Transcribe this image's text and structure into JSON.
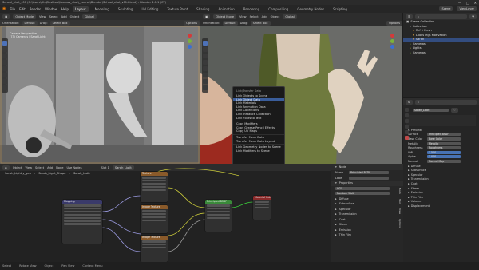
{
  "window": {
    "title": "School_shot_v01 (C:\\Users\\Xtr\\Desktop\\Kosmos_shot\\_course\\Blender\\School_shot_v01.blend) - Blender 4.1.1 (CT)",
    "controls": [
      "—",
      "□",
      "✕"
    ]
  },
  "menu": {
    "items": [
      "File",
      "Edit",
      "Render",
      "Window",
      "Help"
    ],
    "tabs": [
      "Layout",
      "Modeling",
      "Sculpting",
      "UV Editing",
      "Texture Paint",
      "Shading",
      "Animation",
      "Rendering",
      "Compositing",
      "Geometry Nodes",
      "Scripting"
    ],
    "active_tab": "Layout",
    "scene_label": "Scene",
    "view_layer_label": "ViewLayer"
  },
  "left_viewport": {
    "mode": "Object Mode",
    "menus": [
      "View",
      "Select",
      "Add",
      "Object"
    ],
    "orientation": "Global",
    "options_label": "Options",
    "camera_info": [
      "Camera Perspective",
      "(73) Cameras | SarahLight"
    ],
    "sub_header": [
      "Orientation:",
      "Default",
      "Drag:",
      "Select Box"
    ]
  },
  "right_viewport": {
    "mode": "Object Mode",
    "menus": [
      "View",
      "Select",
      "Add",
      "Object"
    ],
    "orientation": "Global",
    "options_label": "Options",
    "sub_header": [
      "Orientation:",
      "Default",
      "Drag:",
      "Select Box"
    ]
  },
  "context_menu": {
    "title": "Link/Transfer Data",
    "items": [
      "Link Objects to Scene",
      "Link Object Data",
      "Link Materials",
      "Link Animation Data",
      "Link Collections",
      "Link Instance Collection",
      "Link Fonts to Text",
      "Copy Modifiers",
      "Copy Grease Pencil Effects",
      "Copy UV Maps",
      "Transfer Mesh Data",
      "Transfer Mesh Data Layout",
      "Link Geometry Nodes to Scene",
      "Link Modifiers to Scene"
    ],
    "highlighted_index": 1
  },
  "outliner": {
    "search_placeholder": "",
    "items": [
      "Scene Collection",
      "Collection",
      "Ref 1 Mesh",
      "Looks Pigs Motivation",
      "Sarah",
      "Cameras",
      "Lights",
      "Cameras"
    ]
  },
  "node_editor": {
    "editor_menus": [
      "Object",
      "View",
      "Select",
      "Add",
      "Node"
    ],
    "use_nodes": "Use Nodes",
    "material_chip": "Sarah_Liolit",
    "slot_label": "Slot 1",
    "breadcrumb": [
      "Sarah_Lightly_geo",
      "Sarah_Light_Shape",
      "Sarah_Liolit"
    ],
    "nodes": [
      {
        "title": "Mapping"
      },
      {
        "title": "Texture"
      },
      {
        "title": "Image Texture"
      },
      {
        "title": "Image Texture"
      },
      {
        "title": "Principled BSDF"
      },
      {
        "title": "Material Output"
      }
    ]
  },
  "node_panel": {
    "section": "Node",
    "name_label": "Name",
    "name_value": "Principled BSDF",
    "label_label": "Label",
    "properties_title": "Properties",
    "ggx": "GGX",
    "random_walk": "Random Walk",
    "rows": [
      "Diffuse",
      "Subsurface",
      "Specular",
      "Transmission",
      "Coat",
      "Sheen",
      "Emission",
      "Thin Film"
    ],
    "tabs": [
      "Node",
      "Tool",
      "View",
      "Options"
    ]
  },
  "properties": {
    "material": "Sarah_Liolit",
    "preview": "Preview",
    "surface_label": "Surface",
    "surface_value": "Principled BSDF",
    "base_color": "Base Color",
    "metallic": "Metallic",
    "roughness": "Roughness",
    "ior": "IOR",
    "ior_value": "1.500",
    "alpha": "Alpha",
    "alpha_value": "1.000",
    "normal": "Normal",
    "normal_value": "Normal Map",
    "sections": [
      "Diffuse",
      "Subsurface",
      "Specular",
      "Transmission",
      "Coat",
      "Sheen",
      "Emission",
      "Thin Film",
      "Volume",
      "Displacement"
    ]
  },
  "status": {
    "items": [
      "Select",
      "Rotate View",
      "Object",
      "Pan View",
      "Context Menu"
    ]
  },
  "colors": {
    "accent": "#4772b3",
    "node_header_texture": "#8a5a2a",
    "node_header_shader": "#3a8a3a",
    "node_header_output": "#8a2a2a"
  }
}
